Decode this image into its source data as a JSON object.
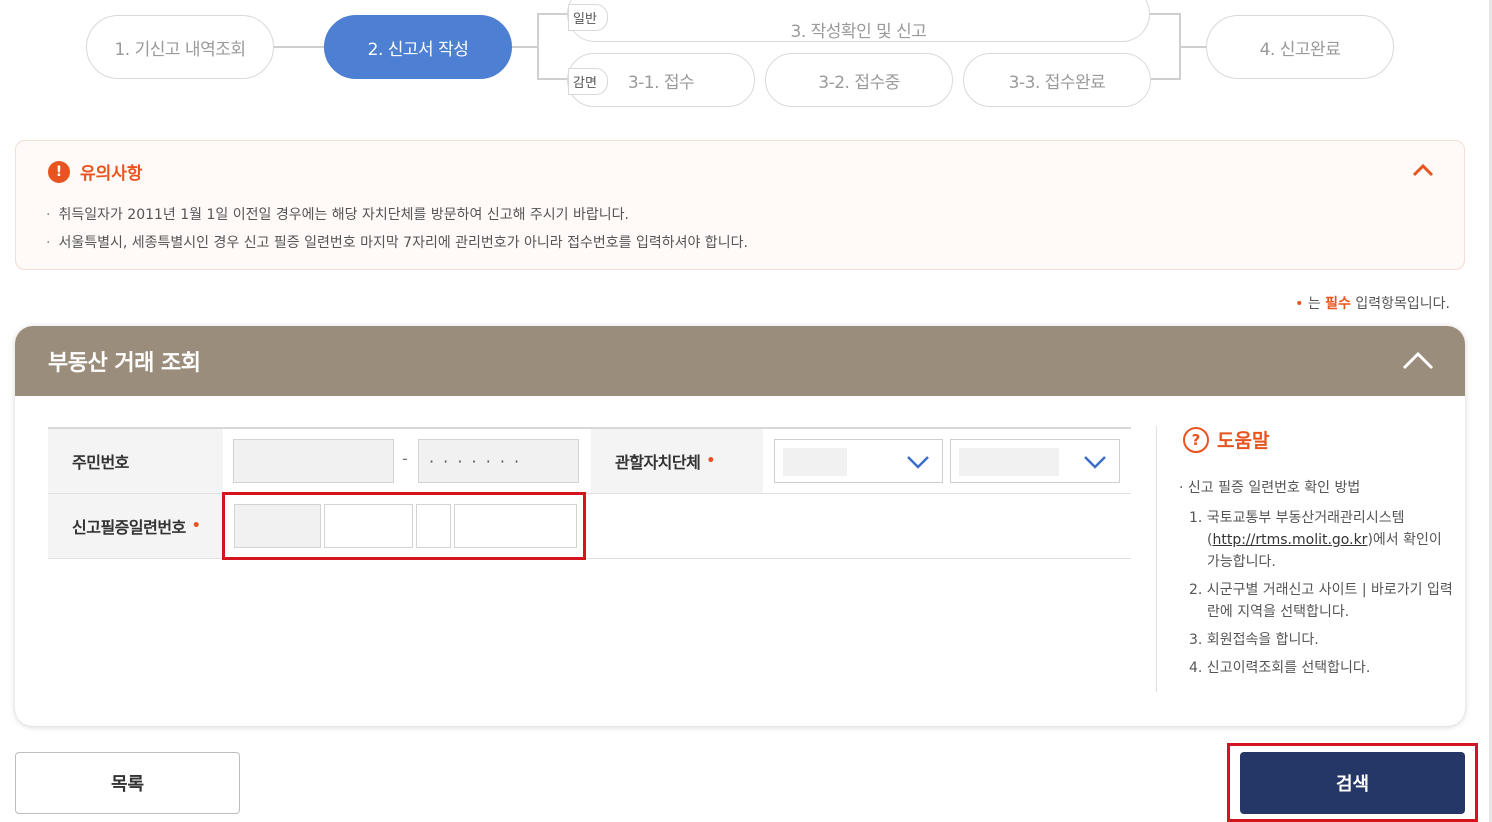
{
  "steps": {
    "step1": "1. 기신고 내역조회",
    "step2": "2. 신고서 작성",
    "step3": "3. 작성확인 및 신고",
    "step31": "3-1. 접수",
    "step32": "3-2. 접수중",
    "step33": "3-3. 접수완료",
    "step4": "4. 신고완료",
    "tag_general": "일반",
    "tag_reduction": "감면",
    "active_color": "#4d7fd3"
  },
  "notice": {
    "title": "유의사항",
    "items": [
      "취득일자가 2011년 1월 1일 이전일 경우에는 해당 자치단체를 방문하여 신고해 주시기 바랍니다.",
      "서울특별시, 세종특별시인 경우 신고 필증 일련번호 마지막 7자리에 관리번호가 아니라 접수번호를 입력하셔야 합니다."
    ],
    "accent_color": "#e8541f"
  },
  "required_note": {
    "prefix": "는",
    "keyword": "필수",
    "suffix": "입력항목입니다."
  },
  "panel": {
    "title": "부동산 거래 조회",
    "header_color": "#9a8d7b",
    "fields": {
      "resident_no_label": "주민번호",
      "resident_no_back": "· · · · · · ·",
      "authority_label": "관할자치단체",
      "certificate_label": "신고필증일련번호"
    },
    "help": {
      "title": "도움말",
      "lead": "신고 필증 일련번호 확인 방법",
      "step1_a": "1. 국토교통부 부동산거래관리시스템 (",
      "step1_link": "http://rtms.molit.go.kr",
      "step1_b": ")에서 확인이 가능합니다.",
      "step2": "2. 시군구별 거래신고 사이트 | 바로가기 입력란에 지역을 선택합니다.",
      "step3": "3. 회원접속을 합니다.",
      "step4": "4. 신고이력조회를 선택합니다."
    }
  },
  "buttons": {
    "list": "목록",
    "search": "검색",
    "search_color": "#243766"
  }
}
